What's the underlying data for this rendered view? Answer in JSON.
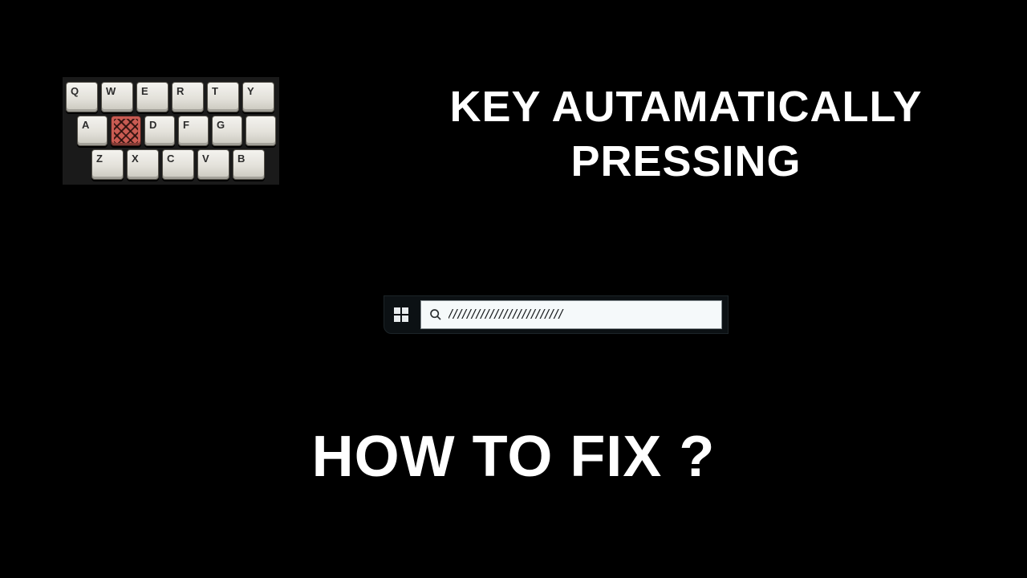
{
  "keyboard": {
    "rows": [
      {
        "indent": 0,
        "keys": [
          {
            "label": "Q"
          },
          {
            "label": "W"
          },
          {
            "label": "E"
          },
          {
            "label": "R"
          },
          {
            "label": "T"
          },
          {
            "label": "Y"
          }
        ]
      },
      {
        "indent": 1,
        "keys": [
          {
            "label": "A"
          },
          {
            "label": "",
            "removed": true
          },
          {
            "label": "D"
          },
          {
            "label": "F"
          },
          {
            "label": "G"
          },
          {
            "label": ""
          }
        ]
      },
      {
        "indent": 2,
        "keys": [
          {
            "label": "Z"
          },
          {
            "label": "X"
          },
          {
            "label": "C"
          },
          {
            "label": "V"
          },
          {
            "label": "B"
          }
        ]
      }
    ]
  },
  "title": {
    "line1": "KEY AUTAMATICALLY",
    "line2": "PRESSING"
  },
  "taskbar": {
    "search_value": "/////////////////////////"
  },
  "bottom": {
    "heading": "HOW TO FIX ?"
  }
}
